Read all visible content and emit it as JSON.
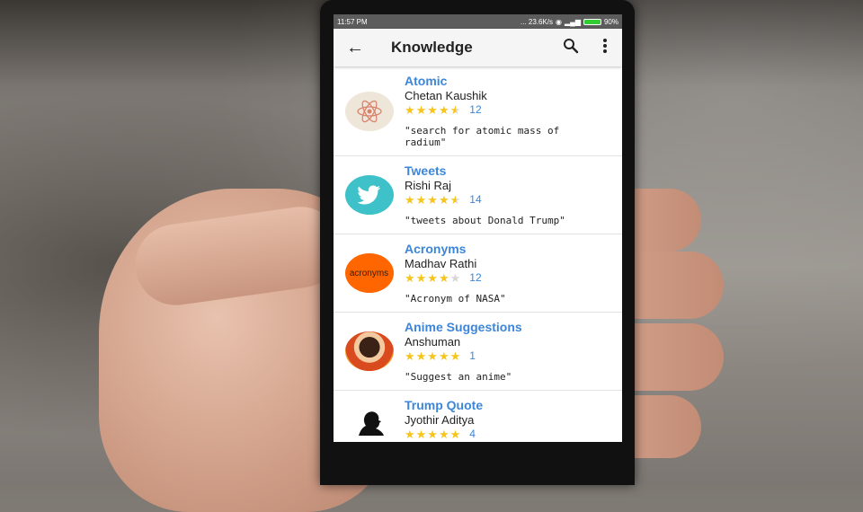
{
  "status": {
    "time": "11:57 PM",
    "speed": "... 23.6K/s",
    "battery": "90%"
  },
  "toolbar": {
    "title": "Knowledge",
    "back_icon": "arrow-left-icon",
    "search_icon": "search-icon",
    "menu_icon": "more-vert-icon"
  },
  "items": [
    {
      "name": "Atomic",
      "author": "Chetan Kaushik",
      "rating": 4.5,
      "count": "12",
      "query": "\"search for atomic mass of radium\"",
      "icon": "atom-icon",
      "color": "#efe6da"
    },
    {
      "name": "Tweets",
      "author": "Rishi Raj",
      "rating": 4.5,
      "count": "14",
      "query": "\"tweets about Donald Trump\"",
      "icon": "twitter-bird-icon",
      "color": "#3fc1c9"
    },
    {
      "name": "Acronyms",
      "author": "Madhav Rathi",
      "rating": 4,
      "count": "12",
      "query": "\"Acronym of NASA\"",
      "icon": "acronyms-logo",
      "logo_text": "acronyms",
      "color": "#ff6600"
    },
    {
      "name": "Anime Suggestions",
      "author": "Anshuman",
      "rating": 5,
      "count": "1",
      "query": "\"Suggest an anime\"",
      "icon": "anime-character-avatar",
      "color": "#e8702a"
    },
    {
      "name": "Trump Quote",
      "author": "Jyothir Aditya",
      "rating": 5,
      "count": "4",
      "query": "",
      "icon": "trump-silhouette-icon",
      "color": "#ffffff"
    }
  ]
}
